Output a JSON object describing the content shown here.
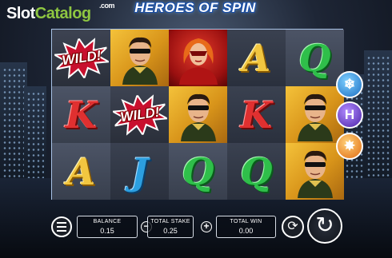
{
  "branding": {
    "logo_slot": "Slot",
    "logo_catalog": "Catalog",
    "logo_com": ".com"
  },
  "game": {
    "title": "HEROES OF SPIN"
  },
  "reels": {
    "columns": [
      [
        "WILD",
        "K",
        "A"
      ],
      [
        "HERO",
        "WILD",
        "J"
      ],
      [
        "HEROINE",
        "HERO",
        "Q"
      ],
      [
        "A",
        "K",
        "Q"
      ],
      [
        "Q",
        "HERO",
        "HERO"
      ]
    ],
    "wild_label": "WILD!"
  },
  "features": [
    {
      "name": "freeze",
      "icon": "snowflake-icon",
      "glyph": "❄"
    },
    {
      "name": "hero",
      "icon": "hero-emblem-icon",
      "glyph": "H"
    },
    {
      "name": "fire",
      "icon": "fire-burst-icon",
      "glyph": "✸"
    }
  ],
  "bottom_bar": {
    "balance_label": "BALANCE",
    "balance_value": "0.15",
    "stake_label": "TOTAL STAKE",
    "stake_value": "0.25",
    "win_label": "TOTAL WIN",
    "win_value": "0.00",
    "minus_symbol": "−",
    "plus_symbol": "+",
    "autoplay_glyph": "⟳",
    "spin_glyph": "↻"
  },
  "colors": {
    "logo_green": "#8ec641",
    "accent_blue": "#6fb6ff",
    "wild_red": "#c8102e"
  }
}
